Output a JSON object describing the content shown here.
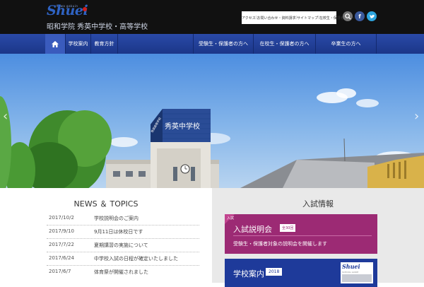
{
  "header": {
    "logo_mark": "Shuei",
    "logo_small": "showa gakuin",
    "school_name": "昭和学院 秀英中学校・高等学校",
    "util_links": [
      "アクセス",
      "お問い合わせ・資料請求",
      "サイトマップ",
      "在校生・保護者の方へ"
    ],
    "social_icons": [
      "search-icon",
      "facebook-icon",
      "twitter-icon"
    ],
    "accent_color": "#1b3688"
  },
  "nav": {
    "home_icon": "⌂",
    "items": [
      "学校案内",
      "教育方針"
    ],
    "right_items": [
      "受験生・保護者の方へ",
      "在校生・保護者の方へ",
      "卒業生の方へ"
    ]
  },
  "hero": {
    "building_sign": "秀英中学校",
    "building_side": "秀英高等学校",
    "prev_arrow": "‹",
    "next_arrow": "›"
  },
  "news": {
    "title": "NEWS ＆ TOPICS",
    "items": [
      {
        "date": "2017/10/2",
        "text": "学校説明会のご案内"
      },
      {
        "date": "2017/9/10",
        "text": "9月11日は休校日です"
      },
      {
        "date": "2017/7/22",
        "text": "夏期講習の実施について"
      },
      {
        "date": "2017/6/24",
        "text": "中学校入試の日程が確定いたしました"
      },
      {
        "date": "2017/6/7",
        "text": "体育祭が開催されました"
      }
    ]
  },
  "right": {
    "title": "入試情報",
    "card1": {
      "tag": "入試",
      "head": "入試説明会",
      "badge": "全30回",
      "sub": "受験生・保護者対象の説明会を開催します"
    },
    "card2": {
      "head": "学校案内",
      "badge": "2018",
      "thumb_title": "Shuei",
      "thumb_sub": "SCHOOL GUIDE"
    }
  }
}
